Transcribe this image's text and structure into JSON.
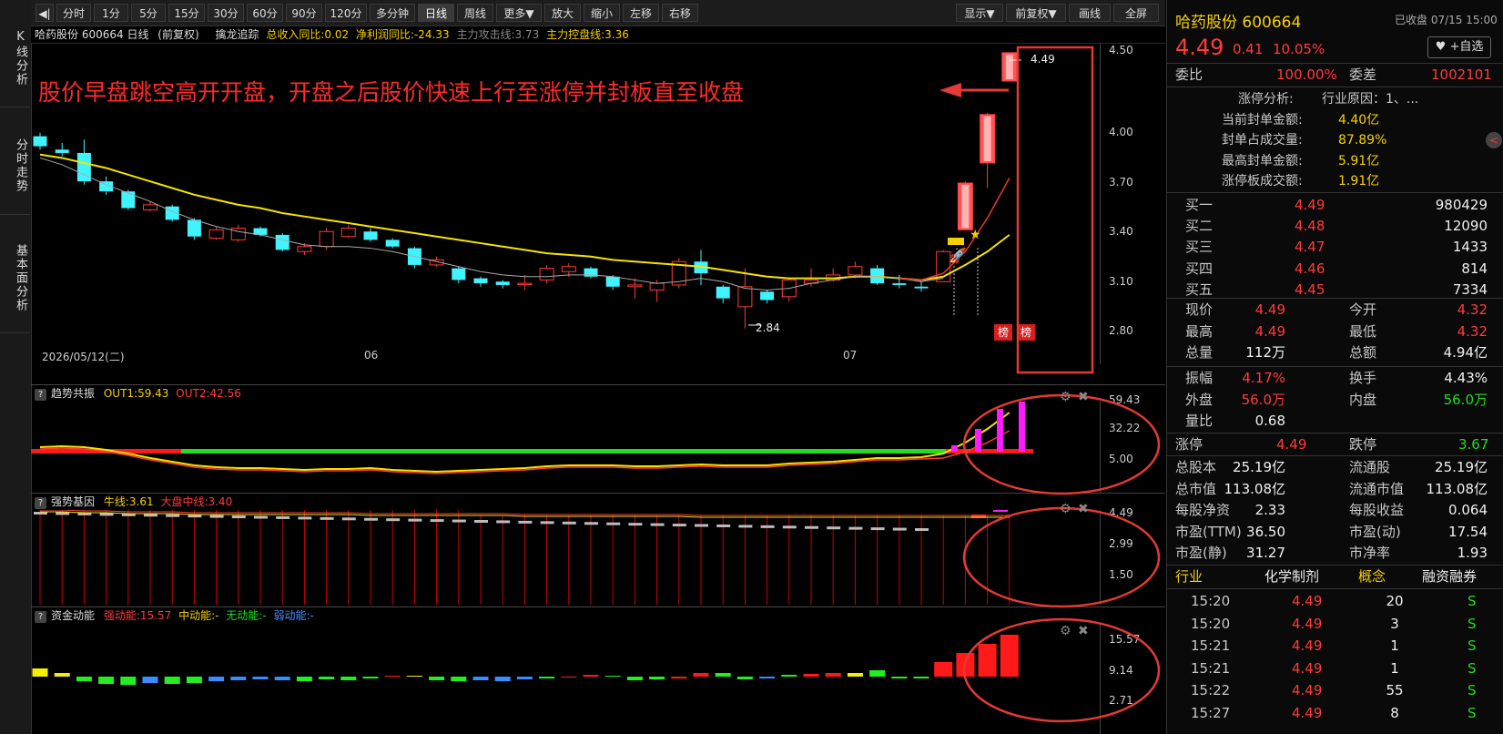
{
  "vtabs": [
    "K线分析",
    "分时走势",
    "基本面分析"
  ],
  "toolbar": {
    "items": [
      "分时",
      "1分",
      "5分",
      "15分",
      "30分",
      "60分",
      "90分",
      "120分",
      "多分钟",
      "日线",
      "周线",
      "更多▼",
      "放大",
      "缩小",
      "左移",
      "右移"
    ],
    "active": "日线",
    "right_items": [
      "显示▼",
      "前复权▼",
      "画线",
      "全屏"
    ]
  },
  "info": {
    "stock": "哈药股份 600664 日线",
    "adjust": "(前复权)",
    "indicator": "擒龙追踪",
    "v1": "总收入同比:0.02",
    "v2": "净利润同比:-24.33",
    "v3": "主力攻击线:3.73",
    "v4": "主力控盘线:3.36"
  },
  "annotation": "股价早盘跳空高开开盘，开盘之后股价快速上行至涨停并封板直至收盘",
  "main_chart": {
    "price_axis": [
      "4.50",
      "4.00",
      "3.70",
      "3.40",
      "3.10",
      "2.80"
    ],
    "dates": [
      "2026/05/12(二)",
      "06",
      "07"
    ],
    "high_label": "4.49",
    "low_label": "2.84",
    "badge": "榜"
  },
  "panels": [
    {
      "title": "趋势共振",
      "v1": "OUT1:59.43",
      "v2": "OUT2:42.56",
      "axis": [
        "59.43",
        "32.22",
        "5.00"
      ]
    },
    {
      "title": "强势基因",
      "v1": "牛线:3.61",
      "v2": "大盘中线:3.40",
      "axis": [
        "4.49",
        "2.99",
        "1.50"
      ]
    },
    {
      "title": "资金动能",
      "v1": "强动能:15.57",
      "v2": "中动能:-",
      "v3": "无动能:-",
      "v4": "弱动能:-",
      "axis": [
        "15.57",
        "9.14",
        "2.71"
      ]
    }
  ],
  "right_panel": {
    "name": "哈药股份 600664",
    "status": "已收盘 07/15 15:00",
    "price": "4.49",
    "change": "0.41",
    "pct": "10.05%",
    "follow_btn": "+自选",
    "weibi_label": "委比",
    "weibi": "100.00%",
    "weicha_label": "委差",
    "weicha": "1002101",
    "zt": [
      {
        "label": "涨停分析:",
        "value": "行业原因：1、..."
      },
      {
        "label": "当前封单金额:",
        "value": "4.40亿"
      },
      {
        "label": "封单占成交量:",
        "value": "87.89%"
      },
      {
        "label": "最高封单金额:",
        "value": "5.91亿"
      },
      {
        "label": "涨停板成交额:",
        "value": "1.91亿"
      }
    ],
    "bids": [
      {
        "label": "买一",
        "price": "4.49",
        "vol": "980429"
      },
      {
        "label": "买二",
        "price": "4.48",
        "vol": "12090"
      },
      {
        "label": "买三",
        "price": "4.47",
        "vol": "1433"
      },
      {
        "label": "买四",
        "price": "4.46",
        "vol": "814"
      },
      {
        "label": "买五",
        "price": "4.45",
        "vol": "7334"
      }
    ],
    "quote": [
      {
        "l1": "现价",
        "v1": "4.49",
        "c1": "red",
        "l2": "今开",
        "v2": "4.32",
        "c2": "red"
      },
      {
        "l1": "最高",
        "v1": "4.49",
        "c1": "red",
        "l2": "最低",
        "v2": "4.32",
        "c2": "red"
      },
      {
        "l1": "总量",
        "v1": "112万",
        "c1": "wht",
        "l2": "总额",
        "v2": "4.94亿",
        "c2": "wht"
      }
    ],
    "quote2": [
      {
        "l1": "振幅",
        "v1": "4.17%",
        "c1": "red",
        "l2": "换手",
        "v2": "4.43%",
        "c2": "wht"
      },
      {
        "l1": "外盘",
        "v1": "56.0万",
        "c1": "red",
        "l2": "内盘",
        "v2": "56.0万",
        "c2": "green"
      },
      {
        "l1": "量比",
        "v1": "0.68",
        "c1": "wht",
        "l2": "",
        "v2": "",
        "c2": "wht"
      }
    ],
    "limit": {
      "l1": "涨停",
      "v1": "4.49",
      "l2": "跌停",
      "v2": "3.67"
    },
    "fund": [
      {
        "l1": "总股本",
        "v1": "25.19亿",
        "l2": "流通股",
        "v2": "25.19亿"
      },
      {
        "l1": "总市值",
        "v1": "113.08亿",
        "l2": "流通市值",
        "v2": "113.08亿"
      },
      {
        "l1": "每股净资",
        "v1": "2.33",
        "l2": "每股收益",
        "v2": "0.064"
      },
      {
        "l1": "市盈(TTM)",
        "v1": "36.50",
        "l2": "市盈(动)",
        "v2": "17.54"
      },
      {
        "l1": "市盈(静)",
        "v1": "31.27",
        "l2": "市净率",
        "v2": "1.93"
      }
    ],
    "cat": {
      "c1": "行业",
      "c2": "化学制剂",
      "c3": "概念",
      "c4": "融资融券"
    },
    "ticks": [
      {
        "t": "15:20",
        "p": "4.49",
        "v": "20",
        "s": "S"
      },
      {
        "t": "15:20",
        "p": "4.49",
        "v": "3",
        "s": "S"
      },
      {
        "t": "15:21",
        "p": "4.49",
        "v": "1",
        "s": "S"
      },
      {
        "t": "15:21",
        "p": "4.49",
        "v": "1",
        "s": "S"
      },
      {
        "t": "15:22",
        "p": "4.49",
        "v": "55",
        "s": "S"
      },
      {
        "t": "15:27",
        "p": "4.49",
        "v": "8",
        "s": "S"
      }
    ]
  }
}
